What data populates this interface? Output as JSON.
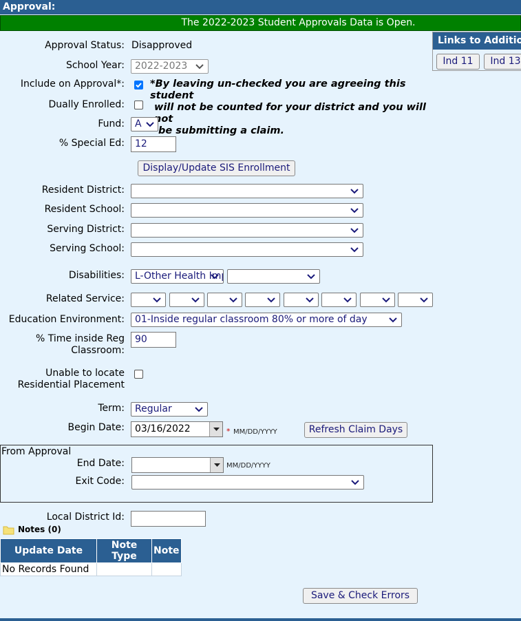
{
  "header": {
    "title": "Approval:"
  },
  "banner": {
    "text": "The 2022-2023 Student Approvals Data is Open."
  },
  "links_panel": {
    "title": "Links to Additional",
    "buttons": [
      "Ind 11",
      "Ind 13"
    ]
  },
  "form": {
    "approval_status": {
      "label": "Approval Status:",
      "value": "Disapproved"
    },
    "school_year": {
      "label": "School Year:",
      "value": "2022-2023"
    },
    "include_on_approval": {
      "label": "Include on Approval*:",
      "checked": true,
      "note": "*By leaving un-checked you are agreeing this student will not be counted for your district and you will not be submitting a claim."
    },
    "note_lines": [
      "*By leaving un-checked you are agreeing this student",
      "will not be counted for your district and you will not",
      "be submitting a claim."
    ],
    "dually_enrolled": {
      "label": "Dually Enrolled:",
      "checked": false
    },
    "fund": {
      "label": "Fund:",
      "value": "A"
    },
    "special_ed": {
      "label": "% Special Ed:",
      "value": "12"
    },
    "sis_button": "Display/Update SIS Enrollment",
    "resident_district": {
      "label": "Resident District:",
      "value": ""
    },
    "resident_school": {
      "label": "Resident School:",
      "value": ""
    },
    "serving_district": {
      "label": "Serving District:",
      "value": ""
    },
    "serving_school": {
      "label": "Serving School:",
      "value": ""
    },
    "disabilities": {
      "label": "Disabilities:",
      "values": [
        "L-Other Health Impairment",
        ""
      ]
    },
    "related_service": {
      "label": "Related Service:",
      "values": [
        "",
        "",
        "",
        "",
        "",
        "",
        "",
        ""
      ]
    },
    "education_environment": {
      "label": "Education Environment:",
      "value": "01-Inside regular classroom 80% or more of day"
    },
    "time_inside": {
      "label_line1": "% Time inside Reg",
      "label_line2": "Classroom:",
      "value": "90"
    },
    "unable_to_locate": {
      "label_line1": "Unable to locate",
      "label_line2": "Residential Placement",
      "checked": false
    },
    "term": {
      "label": "Term:",
      "value": "Regular"
    },
    "begin_date": {
      "label": "Begin Date:",
      "value": "03/16/2022",
      "required_mark": "*",
      "format_hint": "MM/DD/YYYY"
    },
    "refresh_button": "Refresh Claim Days",
    "from_approval": {
      "legend": "From Approval",
      "end_date": {
        "label": "End Date:",
        "value": "",
        "format_hint": "MM/DD/YYYY"
      },
      "exit_code": {
        "label": "Exit Code:",
        "value": ""
      }
    },
    "local_district_id": {
      "label": "Local District Id:",
      "value": ""
    }
  },
  "notes": {
    "title": "Notes (0)",
    "columns": [
      "Update Date",
      "Note Type",
      "Note"
    ],
    "empty_text": "No Records Found"
  },
  "save_button": "Save & Check Errors",
  "colors": {
    "header": "#2b5f92",
    "banner": "#008000",
    "background": "#e6f3fd",
    "checkbox": "#0075ff"
  }
}
